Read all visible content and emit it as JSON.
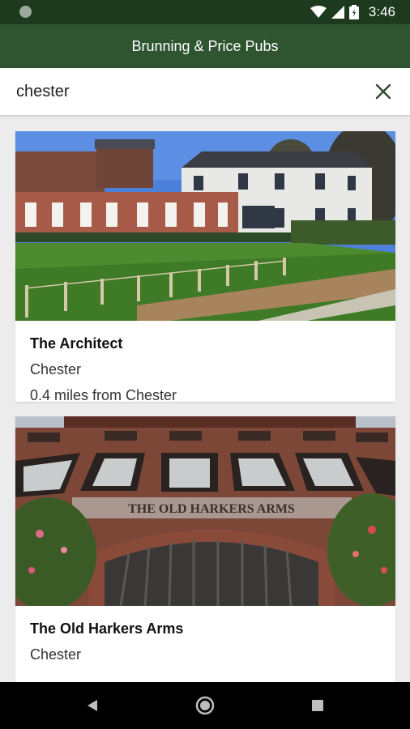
{
  "status": {
    "time": "3:46"
  },
  "app": {
    "title": "Brunning & Price Pubs"
  },
  "search": {
    "value": "chester",
    "clear_icon": "close-icon"
  },
  "results": [
    {
      "name": "The Architect",
      "location": "Chester",
      "distance": "0.4 miles from Chester"
    },
    {
      "name": "The Old Harkers Arms",
      "location": "Chester",
      "distance": "",
      "sign_text": "THE OLD HARKERS ARMS"
    }
  ],
  "colors": {
    "app_bar": "#2e5530",
    "status_bar": "#1e3a1e"
  }
}
